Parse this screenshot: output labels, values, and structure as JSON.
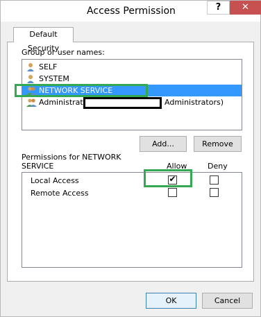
{
  "window": {
    "title": "Access Permission",
    "help_label": "?",
    "close_label": "✕"
  },
  "tabs": [
    {
      "label": "Default Security"
    }
  ],
  "groups": {
    "label": "Group or user names:",
    "items": [
      {
        "label": "SELF",
        "icon": "user-icon",
        "selected": false
      },
      {
        "label": "SYSTEM",
        "icon": "user-icon",
        "selected": false
      },
      {
        "label": "NETWORK SERVICE",
        "icon": "user-group-icon",
        "selected": true
      },
      {
        "label": "Administrators",
        "label_suffix": "Administrators)",
        "icon": "user-group-icon",
        "selected": false
      }
    ],
    "add_label": "Add...",
    "remove_label": "Remove"
  },
  "permissions": {
    "label_line1": "Permissions for NETWORK",
    "label_line2": "SERVICE",
    "allow_header": "Allow",
    "deny_header": "Deny",
    "rows": [
      {
        "name": "Local Access",
        "allow": true,
        "deny": false
      },
      {
        "name": "Remote Access",
        "allow": false,
        "deny": false
      }
    ]
  },
  "footer": {
    "ok_label": "OK",
    "cancel_label": "Cancel"
  },
  "colors": {
    "selection": "#3399ff",
    "highlight_box": "#34a853",
    "close_button": "#c75050"
  }
}
